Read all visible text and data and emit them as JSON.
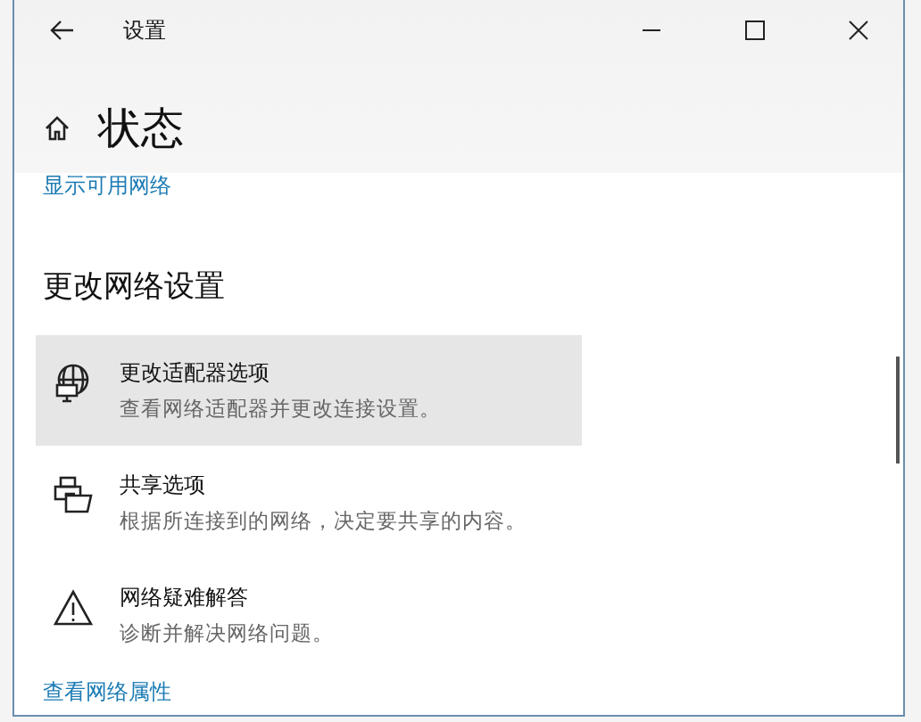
{
  "window": {
    "title": "设置"
  },
  "page_title": "状态",
  "top_link": "显示可用网络",
  "section_heading": "更改网络设置",
  "items": [
    {
      "kind": "adapter",
      "title": "更改适配器选项",
      "description": "查看网络适配器并更改连接设置。",
      "selected": true
    },
    {
      "kind": "sharing",
      "title": "共享选项",
      "description": "根据所连接到的网络，决定要共享的内容。",
      "selected": false
    },
    {
      "kind": "troubleshoot",
      "title": "网络疑难解答",
      "description": "诊断并解决网络问题。",
      "selected": false
    }
  ],
  "bottom_link": "查看网络属性"
}
